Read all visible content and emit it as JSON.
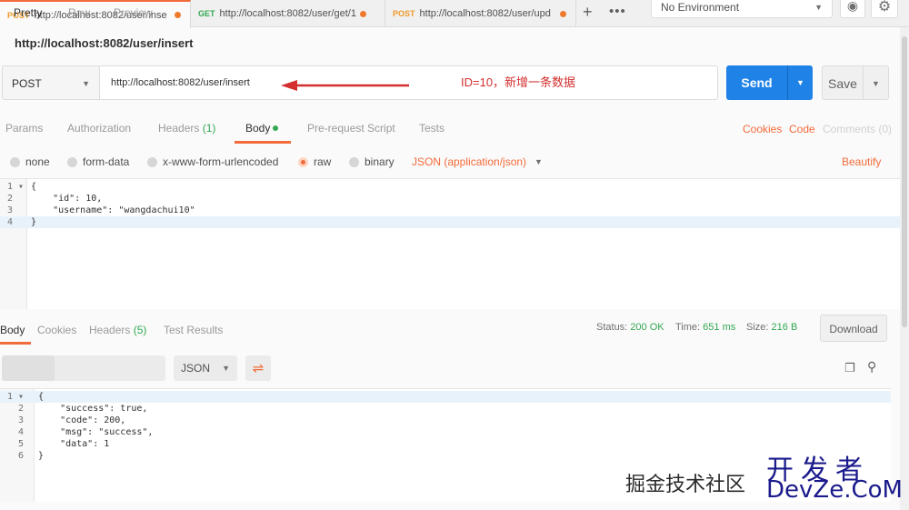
{
  "tabs": [
    {
      "method": "POST",
      "url": "http://localhost:8082/user/inse"
    },
    {
      "method": "GET",
      "url": "http://localhost:8082/user/get/1("
    },
    {
      "method": "POST",
      "url": "http://localhost:8082/user/upd"
    }
  ],
  "environment": "No Environment",
  "request": {
    "title": "http://localhost:8082/user/insert",
    "method": "POST",
    "url": "http://localhost:8082/user/insert",
    "annotation": "ID=10，新增一条数据",
    "send_label": "Send",
    "save_label": "Save"
  },
  "request_tabs": {
    "params": "Params",
    "authorization": "Authorization",
    "headers": "Headers",
    "headers_count": "(1)",
    "body": "Body",
    "prerequest": "Pre-request Script",
    "tests": "Tests",
    "cookies": "Cookies",
    "code": "Code",
    "comments": "Comments (0)"
  },
  "body_types": {
    "none": "none",
    "form_data": "form-data",
    "urlencoded": "x-www-form-urlencoded",
    "raw": "raw",
    "binary": "binary",
    "content_type": "JSON (application/json)",
    "beautify": "Beautify"
  },
  "request_body": {
    "line_numbers": [
      "1 ▾",
      "2",
      "3",
      "4"
    ],
    "lines": [
      "{",
      "    \"id\": 10,",
      "    \"username\": \"wangdachui10\"",
      "}"
    ]
  },
  "response_tabs": {
    "body": "Body",
    "cookies": "Cookies",
    "headers": "Headers",
    "headers_count": "(5)",
    "test_results": "Test Results"
  },
  "response_status": {
    "status_label": "Status:",
    "status_value": "200 OK",
    "time_label": "Time:",
    "time_value": "651 ms",
    "size_label": "Size:",
    "size_value": "216 B",
    "download": "Download"
  },
  "response_view": {
    "pretty": "Pretty",
    "raw": "Raw",
    "preview": "Preview",
    "format": "JSON"
  },
  "response_body": {
    "line_numbers": [
      "1 ▾",
      "2",
      "3",
      "4",
      "5",
      "6"
    ],
    "lines": [
      "{",
      "    \"success\": true,",
      "    \"code\": 200,",
      "    \"msg\": \"success\",",
      "    \"data\": 1",
      "}"
    ]
  },
  "watermarks": {
    "juejin": "掘金技术社区",
    "kaifazhe": "开发者",
    "devze": "DevZe.CoM"
  },
  "colors": {
    "accent": "#f26b3a",
    "send": "#1f82e6",
    "success": "#33a852"
  }
}
